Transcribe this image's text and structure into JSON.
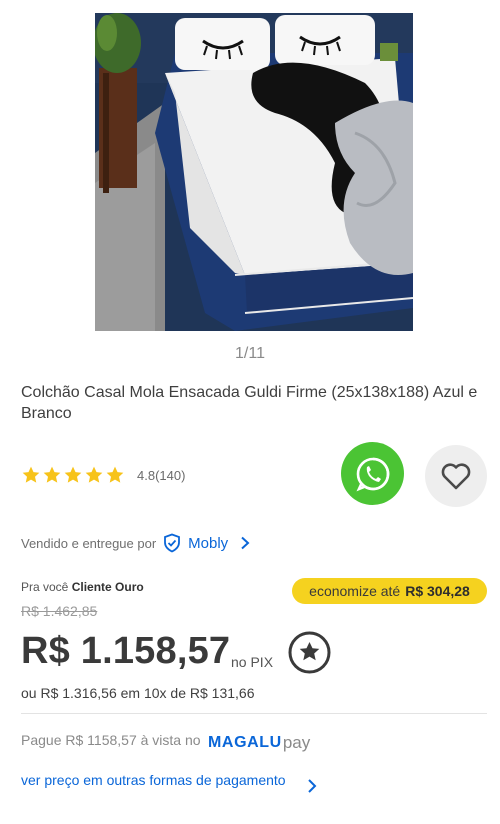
{
  "gallery": {
    "counter": "1/11",
    "image_description_icon": "mattress-photo"
  },
  "product": {
    "title": "Colchão Casal Mola Ensacada Guldi Firme (25x138x188) Azul e Branco"
  },
  "rating": {
    "stars": 5,
    "text": "4.8(140)"
  },
  "actions": {
    "share_icon": "whatsapp-icon",
    "favorite_icon": "heart-icon"
  },
  "seller": {
    "prefix": "Vendido e entregue por",
    "name": "Mobly"
  },
  "offer": {
    "customer_prefix": "Pra você",
    "customer_tier": "Cliente Ouro",
    "economize_label": "economize até",
    "economize_value": "R$ 304,28",
    "old_price": "R$ 1.462,85",
    "price": "R$ 1.158,57",
    "price_suffix": "no PIX",
    "installments": "ou R$ 1.316,56 em 10x de R$ 131,66"
  },
  "payment": {
    "pay_text": "Pague R$ 1158,57 à vista no",
    "brand_magalu": "MAGALU",
    "brand_pay": "pay",
    "other_forms": "ver preço em outras formas de pagamento"
  },
  "colors": {
    "accent_blue": "#0a66d8",
    "whatsapp_green": "#4bc434",
    "badge_yellow": "#f5d21f",
    "star_yellow": "#f7c31a"
  }
}
